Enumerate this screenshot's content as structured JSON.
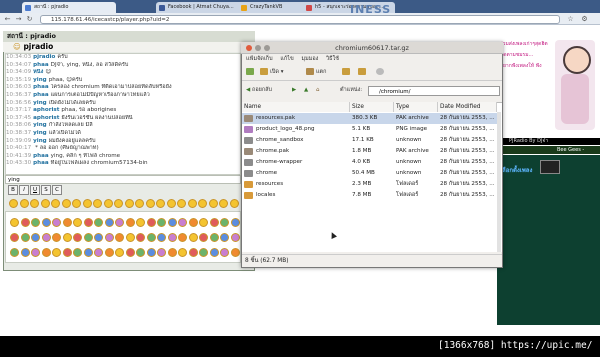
{
  "browser": {
    "tabs": [
      {
        "label": "สถานี : pjradio"
      },
      {
        "label": "Facebook | Atmat Chuya..."
      },
      {
        "label": "CrazyTankVB"
      },
      {
        "label": "h5 - สนุกเจาะร่องความสุขอะ..."
      }
    ],
    "url": "115.178.61.46/icecastcp/player.php?uid=2",
    "brand_fragment": "INESS"
  },
  "chat": {
    "station_title": "สถานี : pjradio",
    "user_header": "pjradio",
    "messages": [
      {
        "time": "10:34:03",
        "name": "pjradio",
        "text": "ครับ"
      },
      {
        "time": "10:34:07",
        "name": "phaa",
        "text": "DJจ๋า, ying, หนิง, ลอ สวัสดีครับ"
      },
      {
        "time": "10:34:09",
        "name": "หนิง",
        "text": "😊"
      },
      {
        "time": "10:35:19",
        "name": "ying",
        "text": "phaa, 😊ครับ"
      },
      {
        "time": "10:36:03",
        "name": "phaa",
        "text": "ใครลอง chromium ที่ติดเอามาปล่อยที่ดลับหรือยัง"
      },
      {
        "time": "10:36:37",
        "name": "phaa",
        "text": "แผนการเตอไม่มีปัญหาเรื่องภาษาไทยแล้ว"
      },
      {
        "time": "10:36:56",
        "name": "ying",
        "text": "เปิดยังไม่ได้เลยครับ"
      },
      {
        "time": "10:37:17",
        "name": "aphorist",
        "text": "phaa, รอ aborigines"
      },
      {
        "time": "10:37:45",
        "name": "aphorist",
        "text": "ยังรันเวอร์ชั่น ผลงานปล่อยที่นี่"
      },
      {
        "time": "10:38:06",
        "name": "ying",
        "text": "กำลังโหลดเลย มีลี"
      },
      {
        "time": "10:38:37",
        "name": "ying",
        "text": "แล้วเปิดไม่ได้"
      },
      {
        "time": "10:39:09",
        "name": "ying",
        "text": "ผมยังคงอยู่แลลครับ"
      },
      {
        "time": "10:40:17",
        "name": "",
        "text": "* ลอ ออก (ศิษย์ญาณพาท)"
      },
      {
        "time": "10:41:39",
        "name": "phaa",
        "text": "ying, คลิก ๆ ที่ไฟล์ chrome"
      },
      {
        "time": "10:43:30",
        "name": "phaa",
        "text": "ที่อยู่ในไฟล์เผลง chromium57134-bin"
      }
    ],
    "input_label": "ying",
    "format_buttons": [
      "B",
      "I",
      "U",
      "S",
      "C"
    ]
  },
  "ad": {
    "radio_label": "PJRadio By DJจ๋า",
    "bee_label": "Bee Gees - ",
    "link_text": "เลือกตั้งเพลง",
    "promo_lines": [
      "ร่วมส่งเพลงเก่าๆสุดฮิต",
      "ติดตามชมรม...",
      "อยากฟังเพลงให้ ฟัง"
    ]
  },
  "filemanager": {
    "title": "chromium60617.tar.gz",
    "menu": [
      "แฟ้มจัดเก็บ",
      "แก้ไข",
      "มุมมอง",
      "วิธีใช้"
    ],
    "toolbar": {
      "open": "เปิด",
      "extract": "แตก"
    },
    "nav": {
      "back": "ถอยกลับ",
      "location_label": "ตำแหน่ง:",
      "location": "/chromium/"
    },
    "columns": [
      "Name",
      "Size",
      "Type",
      "Date Modified"
    ],
    "files": [
      {
        "name": "resources.pak",
        "size": "380.3 KB",
        "type": "PAK archive",
        "date": "28 กันยายน 2553, ..."
      },
      {
        "name": "product_logo_48.png",
        "size": "5.1 KB",
        "type": "PNG image",
        "date": "28 กันยายน 2553, ..."
      },
      {
        "name": "chrome_sandbox",
        "size": "17.1 KB",
        "type": "unknown",
        "date": "28 กันยายน 2553, ..."
      },
      {
        "name": "chrome.pak",
        "size": "1.8 MB",
        "type": "PAK archive",
        "date": "28 กันยายน 2553, ..."
      },
      {
        "name": "chrome-wrapper",
        "size": "4.0 KB",
        "type": "unknown",
        "date": "28 กันยายน 2553, ..."
      },
      {
        "name": "chrome",
        "size": "50.4 MB",
        "type": "unknown",
        "date": "28 กันยายน 2553, ..."
      },
      {
        "name": "resources",
        "size": "2.3 MB",
        "type": "โฟลเดอร์",
        "date": "28 กันยายน 2553, ..."
      },
      {
        "name": "locales",
        "size": "7.8 MB",
        "type": "โฟลเดอร์",
        "date": "28 กันยายน 2553, ..."
      }
    ],
    "status": "8 ชิ้น (62.7 MB)"
  },
  "watermark": "[1366x768] https://upic.me/"
}
